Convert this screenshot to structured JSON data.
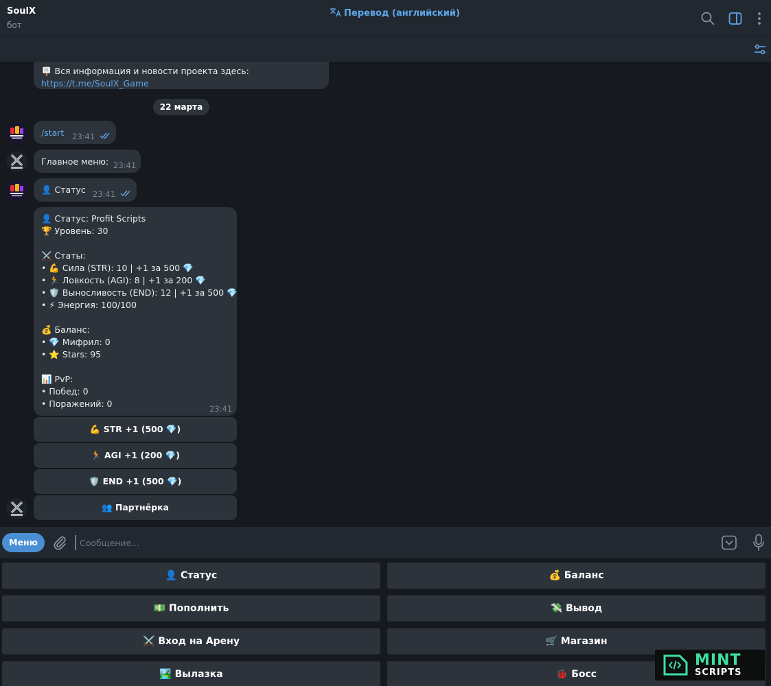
{
  "header": {
    "title": "SoulX",
    "subtitle": "бот",
    "translate_label": "Перевод (английский)"
  },
  "messages": {
    "top": {
      "line1": "🪧 Вся информация и новости проекта здесь:",
      "link": "https://t.me/SoulX_Game"
    },
    "date": "22 марта",
    "start": {
      "text": "/start",
      "time": "23:41"
    },
    "main_menu": {
      "text": "Главное меню:",
      "time": "23:41"
    },
    "status_cmd": {
      "text": "👤 Статус",
      "time": "23:41"
    },
    "status_card": {
      "time": "23:41",
      "lines": [
        "👤 Статус: Profit Scripts",
        "🏆 Уровень: 30",
        "",
        "⚔️ Статы:",
        "• 💪 Сила (STR): 10  |  +1 за 500 💎",
        "• 🏃 Ловкость (AGI): 8  |  +1 за 200 💎",
        "• 🛡️ Выносливость (END): 12  |  +1 за 500 💎",
        "• ⚡ Энергия: 100/100",
        "",
        "💰 Баланс:",
        "• 💎 Мифрил: 0",
        "• ⭐ Stars: 95",
        "",
        "📊 PvP:",
        "• Побед: 0",
        "• Поражений: 0"
      ]
    },
    "inline_buttons": [
      "💪 STR +1  (500 💎)",
      "🏃 AGI +1  (200 💎)",
      "🛡️ END +1  (500 💎)",
      "👥 Партнёрка"
    ]
  },
  "composer": {
    "menu_label": "Меню",
    "placeholder": "Сообщение..."
  },
  "keyboard": [
    "👤 Статус",
    "💰 Баланс",
    "💵 Пополнить",
    "💸 Вывод",
    "⚔️ Вход на Арену",
    "🛒 Магазин",
    "🏞️ Вылазка",
    "🐞 Босс"
  ],
  "watermark": {
    "line1": "MINT",
    "line2": "SCRIPTS"
  },
  "avatars": {
    "bot_logo": "SOULX",
    "user_logo": "PROFIT SCRIPTS"
  },
  "colors": {
    "accent": "#4a8fd3",
    "link": "#5ea6e8",
    "bubble": "#2d333b",
    "background": "#16191e"
  }
}
